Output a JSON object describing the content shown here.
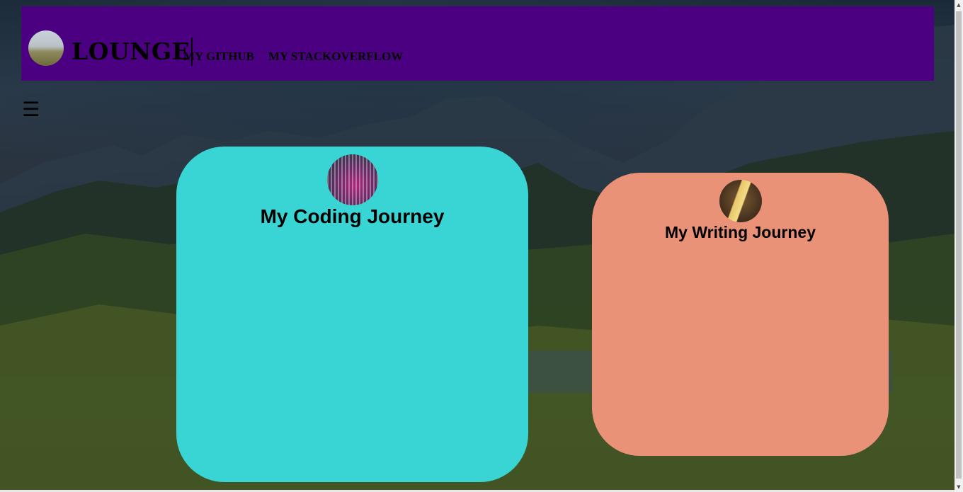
{
  "header": {
    "brand": "LOUNGE",
    "nav": [
      {
        "label": "MY GITHUB"
      },
      {
        "label": "MY STACKOVERFLOW"
      }
    ],
    "background_color": "#4b0082"
  },
  "menu": {
    "icon": "hamburger-icon",
    "glyph": "☰"
  },
  "cards": [
    {
      "title": "My Coding Journey",
      "color": "#39d5d5",
      "icon": "code-screen-avatar"
    },
    {
      "title": "My Writing Journey",
      "color": "#ea9278",
      "icon": "writing-avatar"
    }
  ],
  "scrollbar": {
    "up_glyph": "▲",
    "down_glyph": "▼"
  }
}
